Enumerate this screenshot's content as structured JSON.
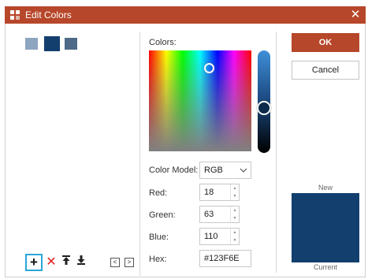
{
  "window": {
    "title": "Edit Colors",
    "close_glyph": "✕"
  },
  "swatches": [
    "#8ea5bf",
    "#123f6e",
    "#4e6a87"
  ],
  "toolbar": {
    "add_glyph": "+",
    "delete_glyph": "✕",
    "move_top_glyph": "⤒",
    "move_bottom_glyph": "⤓",
    "prev_glyph": "<",
    "next_glyph": ">"
  },
  "picker": {
    "colors_label": "Colors:"
  },
  "fields": {
    "color_model_label": "Color Model:",
    "color_model_value": "RGB",
    "red_label": "Red:",
    "red_value": "18",
    "green_label": "Green:",
    "green_value": "63",
    "blue_label": "Blue:",
    "blue_value": "110",
    "hex_label": "Hex:",
    "hex_value": "#123F6E"
  },
  "buttons": {
    "ok": "OK",
    "cancel": "Cancel"
  },
  "preview": {
    "new_label": "New",
    "current_label": "Current",
    "color": "#123f6e"
  },
  "colors": {
    "accent": "#b7472a",
    "focus": "#2aa6d9"
  }
}
